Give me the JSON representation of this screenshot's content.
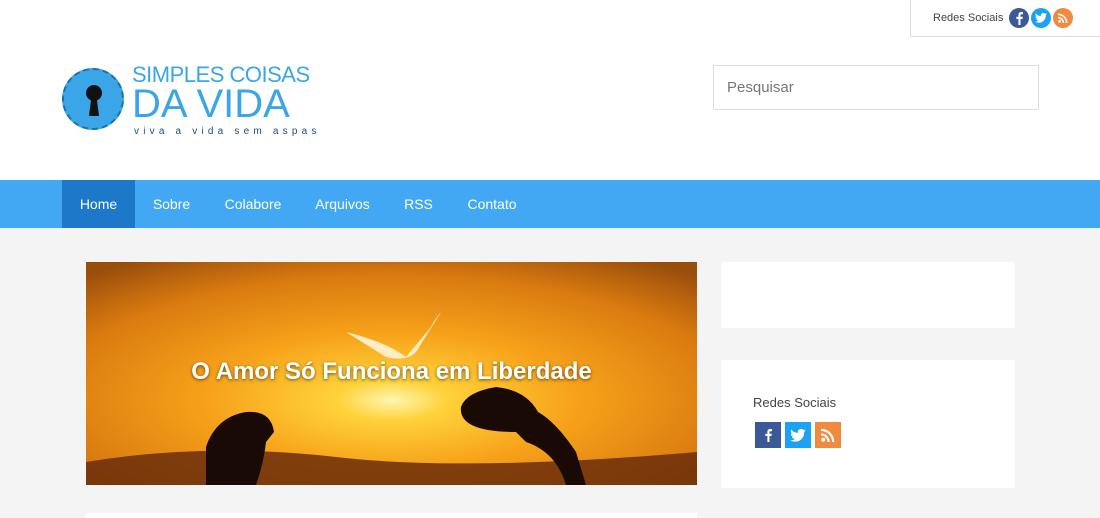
{
  "header": {
    "social_label": "Redes Sociais",
    "social_icons": [
      "facebook-icon",
      "twitter-icon",
      "rss-icon"
    ],
    "logo": {
      "line1": "SIMPLES COISAS",
      "line2": "DA VIDA",
      "tagline": "viva a vida sem aspas"
    },
    "search_placeholder": "Pesquisar"
  },
  "nav": {
    "items": [
      {
        "label": "Home",
        "active": true
      },
      {
        "label": "Sobre"
      },
      {
        "label": "Colabore"
      },
      {
        "label": "Arquivos"
      },
      {
        "label": "RSS"
      },
      {
        "label": "Contato"
      }
    ]
  },
  "featured": {
    "title": "O Amor Só Funciona em Liberdade"
  },
  "sidebar": {
    "social_title": "Redes Sociais",
    "social_icons": [
      "facebook-icon",
      "twitter-icon",
      "rss-icon"
    ]
  },
  "colors": {
    "nav_bg": "#42a8f3",
    "nav_active": "#1e78c9",
    "brand_blue": "#3aa6e8",
    "facebook": "#3b5998",
    "twitter": "#1da1f2",
    "rss": "#f08a3e"
  }
}
